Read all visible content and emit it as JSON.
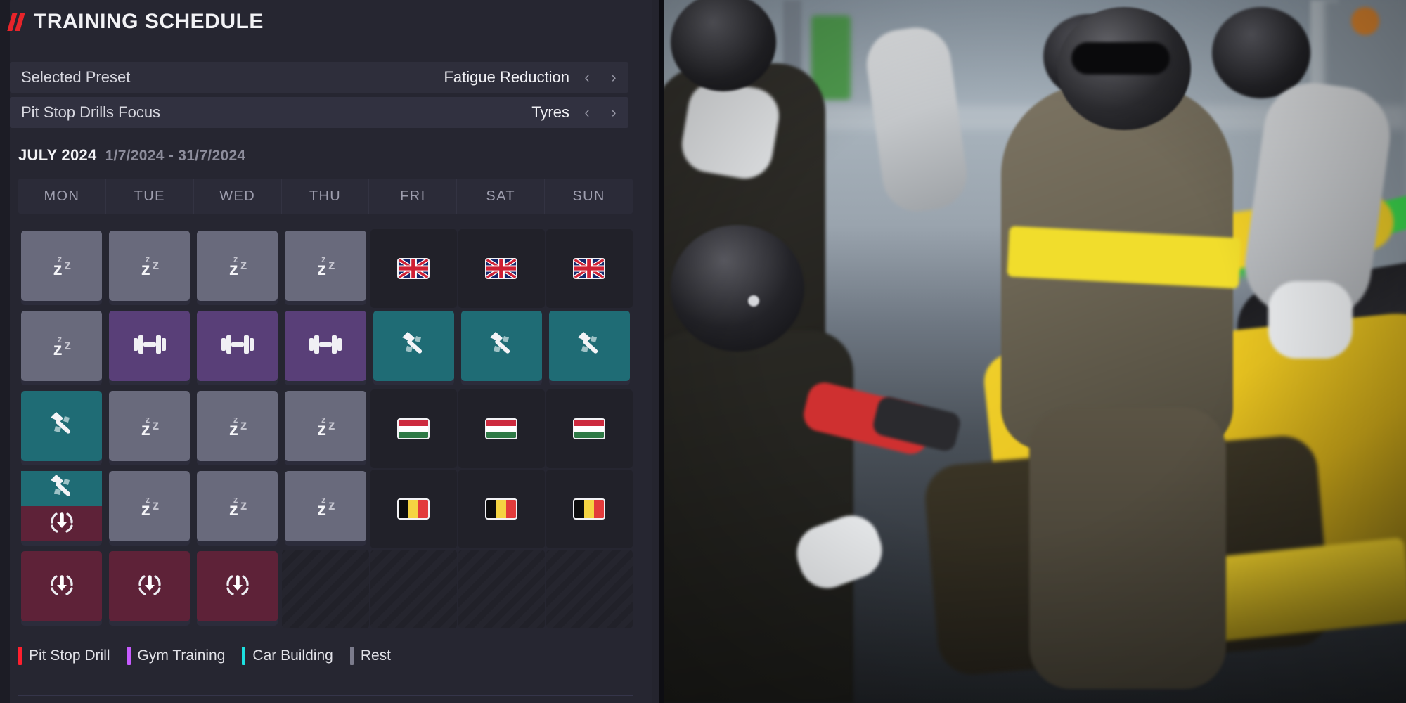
{
  "header": {
    "title": "TRAINING SCHEDULE",
    "accent": "#e8242a"
  },
  "settings": [
    {
      "label": "Selected Preset",
      "value": "Fatigue Reduction",
      "prev": "‹",
      "next": "›"
    },
    {
      "label": "Pit Stop Drills Focus",
      "value": "Tyres",
      "prev": "‹",
      "next": "›"
    }
  ],
  "calendar": {
    "month": "JULY 2024",
    "range": "1/7/2024 - 31/7/2024",
    "day_headers": [
      "MON",
      "TUE",
      "WED",
      "THU",
      "FRI",
      "SAT",
      "SUN"
    ],
    "weeks": [
      [
        {
          "type": "rest",
          "icon": "zzz-icon"
        },
        {
          "type": "rest",
          "icon": "zzz-icon"
        },
        {
          "type": "rest",
          "icon": "zzz-icon"
        },
        {
          "type": "rest",
          "icon": "zzz-icon"
        },
        {
          "type": "race",
          "icon": "flag-gb-icon",
          "flag": "GB"
        },
        {
          "type": "race",
          "icon": "flag-gb-icon",
          "flag": "GB"
        },
        {
          "type": "race",
          "icon": "flag-gb-icon",
          "flag": "GB"
        }
      ],
      [
        {
          "type": "rest",
          "icon": "zzz-icon"
        },
        {
          "type": "gym",
          "icon": "dumbbell-icon"
        },
        {
          "type": "gym",
          "icon": "dumbbell-icon"
        },
        {
          "type": "gym",
          "icon": "dumbbell-icon"
        },
        {
          "type": "car",
          "icon": "hammer-icon"
        },
        {
          "type": "car",
          "icon": "hammer-icon"
        },
        {
          "type": "car",
          "icon": "hammer-icon"
        }
      ],
      [
        {
          "type": "car",
          "icon": "hammer-icon"
        },
        {
          "type": "rest",
          "icon": "zzz-icon"
        },
        {
          "type": "rest",
          "icon": "zzz-icon"
        },
        {
          "type": "rest",
          "icon": "zzz-icon"
        },
        {
          "type": "race",
          "icon": "flag-hu-icon",
          "flag": "HU"
        },
        {
          "type": "race",
          "icon": "flag-hu-icon",
          "flag": "HU"
        },
        {
          "type": "race",
          "icon": "flag-hu-icon",
          "flag": "HU"
        }
      ],
      [
        {
          "type": "split",
          "icon": "hammer-icon",
          "icon2": "pitstop-icon"
        },
        {
          "type": "rest",
          "icon": "zzz-icon"
        },
        {
          "type": "rest",
          "icon": "zzz-icon"
        },
        {
          "type": "rest",
          "icon": "zzz-icon"
        },
        {
          "type": "race",
          "icon": "flag-be-icon",
          "flag": "BE"
        },
        {
          "type": "race",
          "icon": "flag-be-icon",
          "flag": "BE"
        },
        {
          "type": "race",
          "icon": "flag-be-icon",
          "flag": "BE"
        }
      ],
      [
        {
          "type": "pit",
          "icon": "pitstop-icon"
        },
        {
          "type": "pit",
          "icon": "pitstop-icon"
        },
        {
          "type": "pit",
          "icon": "pitstop-icon"
        },
        {
          "type": "striped",
          "icon": ""
        },
        {
          "type": "striped",
          "icon": ""
        },
        {
          "type": "striped",
          "icon": ""
        },
        {
          "type": "striped",
          "icon": ""
        }
      ]
    ]
  },
  "legend": [
    {
      "label": "Pit Stop Drill",
      "color": "#ff1f2e"
    },
    {
      "label": "Gym Training",
      "color": "#c75bff"
    },
    {
      "label": "Car Building",
      "color": "#1ce0e0"
    },
    {
      "label": "Rest",
      "color": "#7b7b8c"
    }
  ],
  "activity_colors": {
    "rest": "#696a7c",
    "gym": "#593f78",
    "car": "#1f6c75",
    "pit": "#5e2238"
  }
}
